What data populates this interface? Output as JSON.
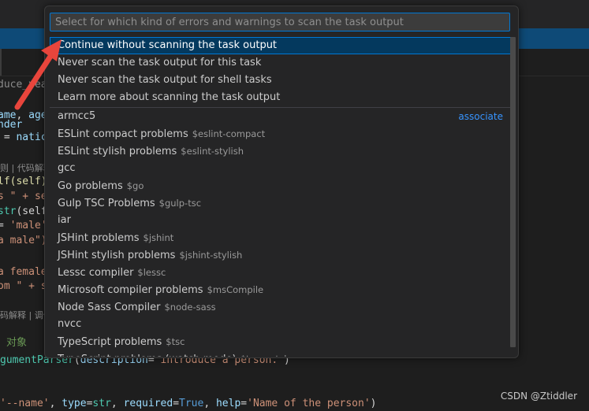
{
  "editor": {
    "partial_tab": "duce_year",
    "lines": [
      {
        "parts": [
          {
            "t": "ame",
            "c": "c-ident"
          },
          {
            "t": ", ",
            "c": "c-white"
          },
          {
            "t": "age",
            "c": "c-ident"
          }
        ]
      },
      {
        "parts": [
          {
            "t": "nder",
            "c": "c-ident"
          }
        ]
      },
      {
        "parts": [
          {
            "t": " = ",
            "c": "c-white"
          },
          {
            "t": "natic",
            "c": "c-ident"
          }
        ]
      },
      {
        "parts": [
          {
            "t": "lf(self)",
            "c": "c-fn"
          }
        ]
      },
      {
        "parts": [
          {
            "t": "s \" + se",
            "c": "c-str"
          }
        ]
      },
      {
        "parts": [
          {
            "t": "str",
            "c": "c-cls"
          },
          {
            "t": "(self",
            "c": "c-white"
          }
        ]
      },
      {
        "parts": [
          {
            "t": "= ",
            "c": "c-white"
          },
          {
            "t": "'male'",
            "c": "c-str"
          }
        ]
      },
      {
        "parts": [
          {
            "t": "a male\")",
            "c": "c-str"
          }
        ]
      },
      {
        "parts": [
          {
            "t": "a female",
            "c": "c-str"
          }
        ]
      },
      {
        "parts": [
          {
            "t": "om \" + s",
            "c": "c-str"
          }
        ]
      },
      {
        "parts": [
          {
            "t": "gumentParser",
            "c": "c-cls"
          },
          {
            "t": "(",
            "c": "c-white"
          },
          {
            "t": "description",
            "c": "c-ident"
          },
          {
            "t": "=",
            "c": "c-white"
          },
          {
            "t": "'introduce a person.'",
            "c": "c-str"
          },
          {
            "t": ")",
            "c": "c-white"
          }
        ]
      },
      {
        "parts": [
          {
            "t": "'--name'",
            "c": "c-str"
          },
          {
            "t": ", ",
            "c": "c-white"
          },
          {
            "t": "type",
            "c": "c-ident"
          },
          {
            "t": "=",
            "c": "c-white"
          },
          {
            "t": "str",
            "c": "c-cls"
          },
          {
            "t": ", ",
            "c": "c-white"
          },
          {
            "t": "required",
            "c": "c-ident"
          },
          {
            "t": "=",
            "c": "c-white"
          },
          {
            "t": "True",
            "c": "c-kw"
          },
          {
            "t": ", ",
            "c": "c-white"
          },
          {
            "t": "help",
            "c": "c-ident"
          },
          {
            "t": "=",
            "c": "c-white"
          },
          {
            "t": "'Name of the person'",
            "c": "c-str"
          },
          {
            "t": ")",
            "c": "c-white"
          }
        ]
      }
    ],
    "hints": [
      "则 | 代码解释",
      "码解释 | 调何"
    ],
    "comment": "对象"
  },
  "quick_pick": {
    "placeholder": "Select for which kind of errors and warnings to scan the task output",
    "value": "",
    "top_items": [
      {
        "label": "Continue without scanning the task output",
        "selected": true
      },
      {
        "label": "Never scan the task output for this task"
      },
      {
        "label": "Never scan the task output for shell tasks"
      },
      {
        "label": "Learn more about scanning the task output"
      }
    ],
    "matchers": [
      {
        "label": "armcc5",
        "desc": "",
        "badge": "associate"
      },
      {
        "label": "ESLint compact problems",
        "desc": "$eslint-compact"
      },
      {
        "label": "ESLint stylish problems",
        "desc": "$eslint-stylish"
      },
      {
        "label": "gcc",
        "desc": ""
      },
      {
        "label": "Go problems",
        "desc": "$go"
      },
      {
        "label": "Gulp TSC Problems",
        "desc": "$gulp-tsc"
      },
      {
        "label": "iar",
        "desc": ""
      },
      {
        "label": "JSHint problems",
        "desc": "$jshint"
      },
      {
        "label": "JSHint stylish problems",
        "desc": "$jshint-stylish"
      },
      {
        "label": "Lessc compiler",
        "desc": "$lessc"
      },
      {
        "label": "Microsoft compiler problems",
        "desc": "$msCompile"
      },
      {
        "label": "Node Sass Compiler",
        "desc": "$node-sass"
      },
      {
        "label": "nvcc",
        "desc": ""
      },
      {
        "label": "TypeScript problems",
        "desc": "$tsc"
      },
      {
        "label": "TypeScript problems (watch mode)",
        "desc": "$tsc-watch"
      }
    ]
  },
  "annotation": {
    "arrow_color": "#e8453c"
  },
  "watermark": "CSDN @Ztiddler"
}
